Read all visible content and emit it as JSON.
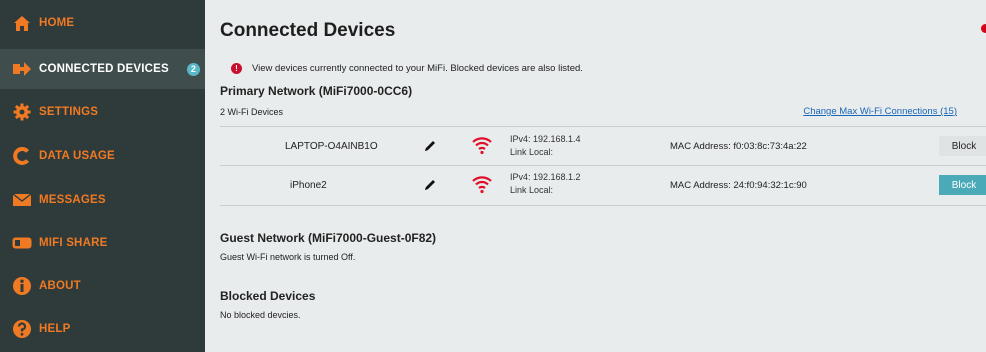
{
  "sidebar": {
    "items": [
      {
        "label": "HOME",
        "icon": "home-icon"
      },
      {
        "label": "CONNECTED DEVICES",
        "icon": "connected-devices-icon",
        "badge": "2"
      },
      {
        "label": "SETTINGS",
        "icon": "gear-icon"
      },
      {
        "label": "DATA USAGE",
        "icon": "data-usage-icon"
      },
      {
        "label": "MESSAGES",
        "icon": "envelope-icon"
      },
      {
        "label": "MIFI SHARE",
        "icon": "mifi-share-icon"
      },
      {
        "label": "ABOUT",
        "icon": "info-icon"
      },
      {
        "label": "HELP",
        "icon": "help-icon"
      }
    ]
  },
  "main": {
    "title": "Connected Devices",
    "info_icon": "!",
    "info_text": "View devices currently connected to your MiFi. Blocked devices are also listed.",
    "primary": {
      "title": "Primary Network (MiFi7000-0CC6)",
      "count_text": "2 Wi-Fi  Devices",
      "change_link": "Change Max Wi-Fi Connections (15)",
      "devices": [
        {
          "name": "LAPTOP-O4AINB1O",
          "ipv4": "IPv4: 192.168.1.4",
          "link_local": "Link Local:",
          "mac": "MAC Address: f0:03:8c:73:4a:22",
          "block": "Block"
        },
        {
          "name": "iPhone2",
          "ipv4": "IPv4: 192.168.1.2",
          "link_local": "Link Local:",
          "mac": "MAC Address: 24:f0:94:32:1c:90",
          "block": "Block"
        }
      ]
    },
    "guest": {
      "title": "Guest Network (MiFi7000-Guest-0F82)",
      "text": "Guest Wi-Fi network is turned Off."
    },
    "blocked": {
      "title": "Blocked Devices",
      "text": "No blocked devcies."
    }
  },
  "colors": {
    "sidebar_bg": "#2f3a3a",
    "sidebar_active_bg": "#3f4d4d",
    "nav_orange": "#f07a23",
    "badge_teal": "#58b8c8",
    "wifi_red": "#e0102a",
    "link_blue": "#1a66b8",
    "block_teal": "#4baab8"
  }
}
